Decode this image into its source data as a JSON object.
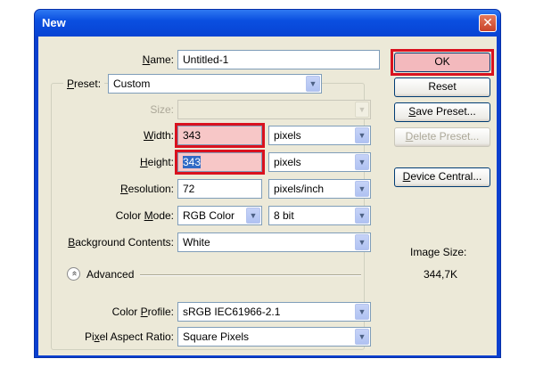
{
  "window": {
    "title": "New",
    "close_glyph": "✕"
  },
  "form": {
    "name_label": "Name:",
    "name_value": "Untitled-1",
    "preset_label": "Preset:",
    "preset_value": "Custom",
    "size_label": "Size:",
    "size_value": "",
    "width_label": "Width:",
    "width_value": "343",
    "width_unit": "pixels",
    "height_label": "Height:",
    "height_value": "343",
    "height_unit": "pixels",
    "resolution_label": "Resolution:",
    "resolution_value": "72",
    "resolution_unit": "pixels/inch",
    "color_mode_label": "Color Mode:",
    "color_mode_value": "RGB Color",
    "bit_depth_value": "8 bit",
    "background_label": "Background Contents:",
    "background_value": "White",
    "advanced_label": "Advanced",
    "advanced_glyph": "«",
    "color_profile_label": "Color Profile:",
    "color_profile_value": "sRGB IEC61966-2.1",
    "pixel_aspect_label": "Pixel Aspect Ratio:",
    "pixel_aspect_value": "Square Pixels"
  },
  "buttons": {
    "ok": "OK",
    "reset": "Reset",
    "save_preset": "Save Preset...",
    "delete_preset": "Delete Preset...",
    "device_central": "Device Central..."
  },
  "info": {
    "image_size_label": "Image Size:",
    "image_size_value": "344,7K"
  },
  "icons": {
    "dropdown": "chevron-down-icon",
    "collapse": "collapse-double-chevron-icon",
    "close": "close-icon"
  },
  "colors": {
    "titlebar": "#0a4fe0",
    "dialog_bg": "#ece9d8",
    "highlight_border": "#d9121f",
    "highlight_fill": "#f7c7c7",
    "selection": "#316ac5"
  }
}
